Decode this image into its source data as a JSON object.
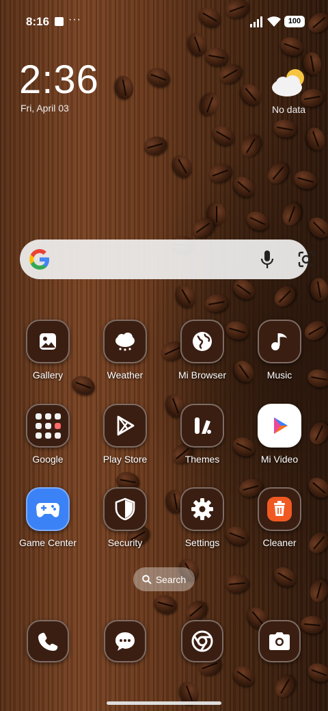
{
  "status_bar": {
    "time": "8:16",
    "overflow": "···",
    "battery": "100"
  },
  "clock_widget": {
    "time": "2:36",
    "date": "Fri, April 03"
  },
  "weather_widget": {
    "icon": "partly-cloudy-icon",
    "text": "No data"
  },
  "google_search": {
    "logo": "google-logo",
    "mic_icon": "mic-icon",
    "lens_icon": "lens-icon"
  },
  "apps": [
    {
      "label": "Gallery",
      "icon": "gallery-icon"
    },
    {
      "label": "Weather",
      "icon": "weather-icon"
    },
    {
      "label": "Mi Browser",
      "icon": "globe-icon"
    },
    {
      "label": "Music",
      "icon": "music-note-icon"
    },
    {
      "label": "Google",
      "icon": "folder-icon"
    },
    {
      "label": "Play Store",
      "icon": "play-store-icon"
    },
    {
      "label": "Themes",
      "icon": "themes-icon"
    },
    {
      "label": "Mi Video",
      "icon": "mi-video-icon"
    },
    {
      "label": "Game Center",
      "icon": "gamepad-icon"
    },
    {
      "label": "Security",
      "icon": "shield-icon"
    },
    {
      "label": "Settings",
      "icon": "gear-icon"
    },
    {
      "label": "Cleaner",
      "icon": "trash-icon"
    }
  ],
  "app_search": {
    "label": "Search"
  },
  "dock": [
    {
      "icon": "phone-icon"
    },
    {
      "icon": "messages-icon"
    },
    {
      "icon": "chrome-icon"
    },
    {
      "icon": "camera-icon"
    }
  ],
  "colors": {
    "icon_bg": "#3a1e12",
    "game_center_blue": "#3b82f6",
    "cleaner_orange": "#f05a22"
  }
}
